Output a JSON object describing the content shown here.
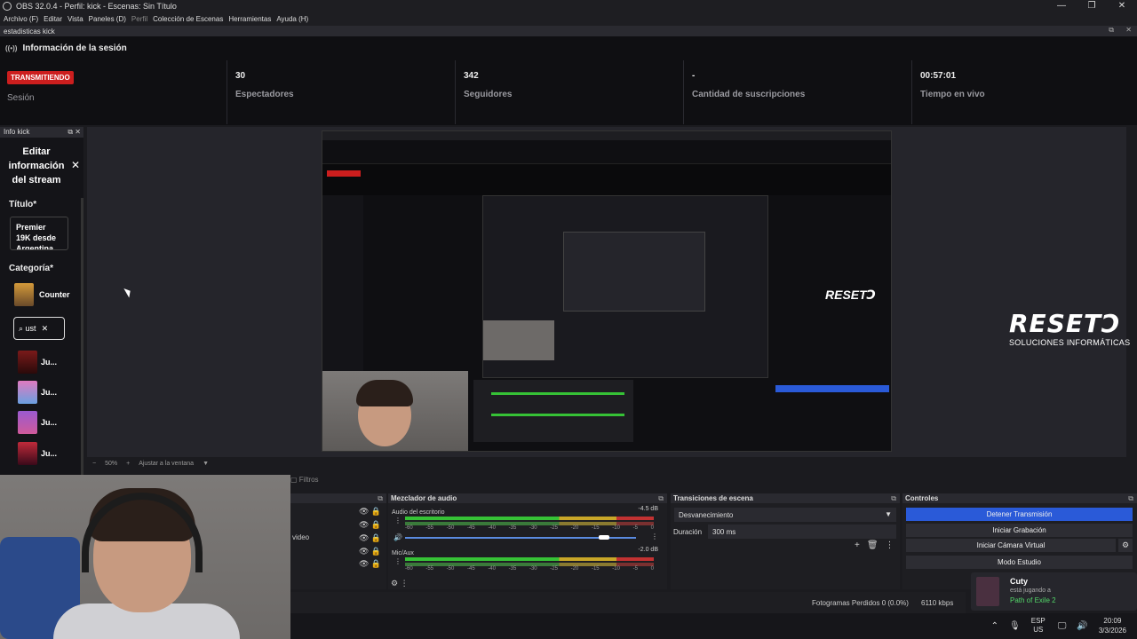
{
  "window": {
    "title": "OBS 32.0.4 - Perfil: kick - Escenas: Sin Título",
    "controls": [
      "—",
      "❐",
      "✕"
    ]
  },
  "menu": [
    "Archivo (F)",
    "Editar",
    "Vista",
    "Paneles (D)",
    "Perfil",
    "Colección de Escenas",
    "Herramientas",
    "Ayuda (H)"
  ],
  "stats_dock": {
    "title": "estadisticas kick",
    "header": "Información de la sesión",
    "status_badge": "TRANSMITIENDO",
    "status_label": "Sesión",
    "viewers_value": "30",
    "viewers_label": "Espectadores",
    "followers_value": "342",
    "followers_label": "Seguidores",
    "subs_value": "-",
    "subs_label": "Cantidad de suscripciones",
    "live_value": "00:57:01",
    "live_label": "Tiempo en vivo",
    "status_color": "#cc1e1e"
  },
  "info_dock": {
    "title": "Info kick",
    "heading": "Editar información del stream",
    "titulo_label": "Título*",
    "titulo_value": "Premier 19K desde Argentina",
    "categoria_label": "Categoría*",
    "categoria_value": "Counter",
    "search_value": "ust",
    "results": [
      "Ju...",
      "Ju...",
      "Ju...",
      "Ju..."
    ]
  },
  "preview": {
    "brand": "RESETↃ",
    "brand_sub": "SOLUCIONES INFORMÁTICAS"
  },
  "zoom": {
    "level": "50%",
    "fit": "Ajustar a la ventana"
  },
  "tabs": {
    "filtros": "Filtros"
  },
  "sources": {
    "partial_item": "video"
  },
  "mixer": {
    "title": "Mezclador de audio",
    "channels": [
      {
        "name": "Audio del escritorio",
        "db": "-4.5 dB"
      },
      {
        "name": "Mic/Aux",
        "db": "-2.0 dB"
      }
    ],
    "scale": [
      "-60",
      "-55",
      "-50",
      "-45",
      "-40",
      "-35",
      "-30",
      "-25",
      "-20",
      "-15",
      "-10",
      "-5",
      "0"
    ]
  },
  "transitions": {
    "title": "Transiciones de escena",
    "selected": "Desvanecimiento",
    "duration_label": "Duración",
    "duration_value": "300 ms"
  },
  "controls": {
    "title": "Controles",
    "stop_stream": "Detener Transmisión",
    "start_recording": "Iniciar Grabación",
    "start_virtual_cam": "Iniciar Cámara Virtual",
    "studio_mode": "Modo Estudio",
    "accent": "#2a5ad8"
  },
  "status": {
    "dropped": "Fotogramas Perdidos 0 (0.0%)",
    "bitrate": "6110 kbps"
  },
  "notification": {
    "name": "Cuty",
    "action": "está jugando a",
    "game": "Path of Exile 2"
  },
  "taskbar": {
    "lang1": "ESP",
    "lang2": "US",
    "time": "20:09",
    "date": "3/3/2026"
  }
}
